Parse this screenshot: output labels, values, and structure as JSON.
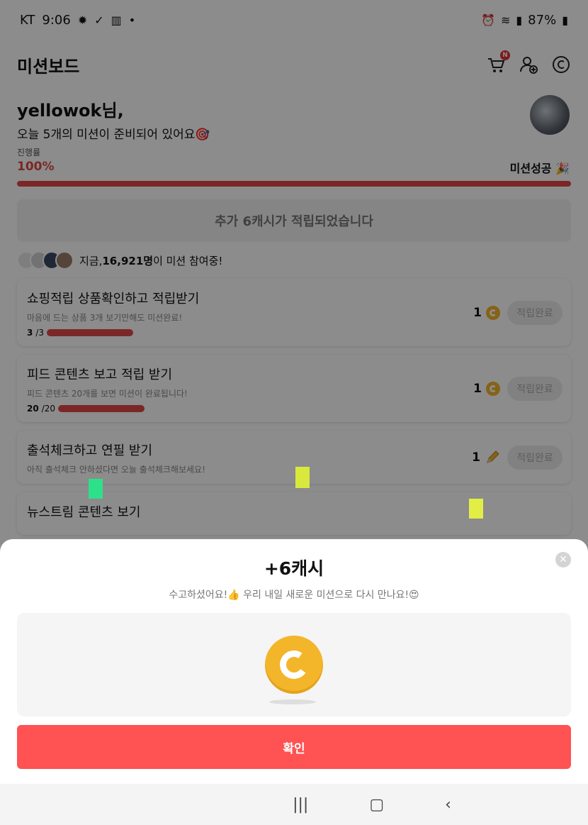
{
  "status_bar": {
    "carrier": "KT",
    "time": "9:06",
    "battery": "87%"
  },
  "header": {
    "title": "미션보드",
    "cart_badge": "N"
  },
  "greeting": {
    "name": "yellowok님,",
    "subtitle": "오늘 5개의 미션이 준비되어 있어요🎯"
  },
  "progress": {
    "label": "진행률",
    "value": "100%",
    "fraction": 1.0,
    "success_label": "미션성공 🎉"
  },
  "notice": "추가 6캐시가 적립되었습니다",
  "participants": {
    "prefix": "지금, ",
    "count": "16,921명",
    "suffix": "이 미션 참여중!"
  },
  "missions": [
    {
      "title": "쇼핑적립 상품확인하고 적립받기",
      "subtitle": "마음에 드는 상품 3개 보기만해도 미션완료!",
      "progress_done": "3",
      "progress_total": "/3",
      "reward": "1",
      "reward_icon": "coin-icon",
      "button": "적립완료"
    },
    {
      "title": "피드 콘텐츠 보고 적립 받기",
      "subtitle": "피드 콘텐츠 20개를 보면 미션이 완료됩니다!",
      "progress_done": "20",
      "progress_total": "/20",
      "reward": "1",
      "reward_icon": "coin-icon",
      "button": "적립완료"
    },
    {
      "title": "출석체크하고 연필 받기",
      "subtitle": "아직 출석체크 안하셨다면 오늘 출석체크해보세요!",
      "reward": "1",
      "reward_icon": "pencil-icon",
      "button": "적립완료"
    },
    {
      "title": "뉴스트림 콘텐츠 보기"
    }
  ],
  "sheet": {
    "title": "+6캐시",
    "description": "수고하셨어요!👍 우리 내일 새로운 미션으로 다시 만나요!😍",
    "confirm_label": "확인"
  },
  "colors": {
    "accent": "#ff5252",
    "progress": "#e04848",
    "coin": "#f3b52a"
  }
}
